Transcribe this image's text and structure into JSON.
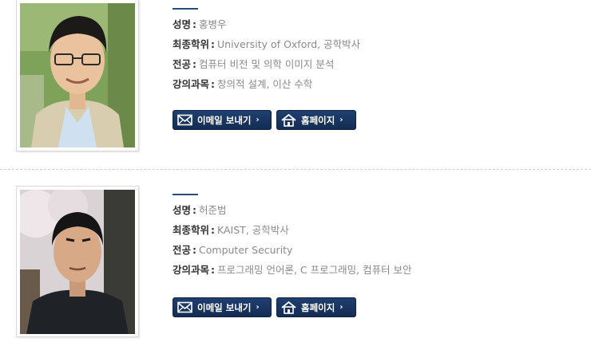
{
  "faculty": [
    {
      "name_label": "성명",
      "name": "홍병우",
      "degree_label": "최종학위",
      "degree": "University of Oxford, 공학박사",
      "major_label": "전공",
      "major": "컴퓨터 비전 및 의학 이미지 분석",
      "courses_label": "강의과목",
      "courses": "창의적 설계, 이산 수학",
      "email_button": "이메일 보내기",
      "home_button": "홈페이지"
    },
    {
      "name_label": "성명",
      "name": "허준범",
      "degree_label": "최종학위",
      "degree": "KAIST, 공학박사",
      "major_label": "전공",
      "major": "Computer Security",
      "courses_label": "강의과목",
      "courses": "프로그래밍 언어론, C 프로그래밍, 컴퓨터 보안",
      "email_button": "이메일 보내기",
      "home_button": "홈페이지"
    }
  ],
  "colors": {
    "button_bg": "#1c3a68",
    "accent_line": "#2b4d7e",
    "label": "#333333",
    "value": "#8a8a8a"
  },
  "icons": {
    "email": "envelope-icon",
    "home": "house-icon",
    "chevron": "chevron-right-icon"
  }
}
